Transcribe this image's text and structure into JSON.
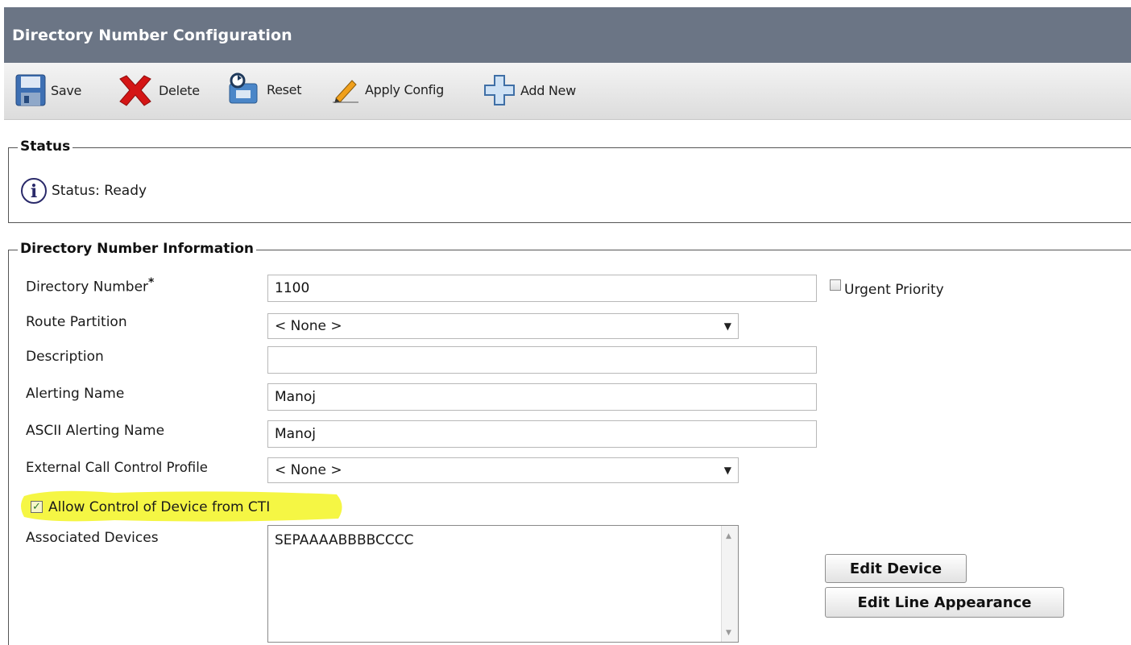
{
  "page": {
    "title": "Directory Number Configuration"
  },
  "toolbar": {
    "save": "Save",
    "delete": "Delete",
    "reset": "Reset",
    "apply_config": "Apply Config",
    "add_new": "Add New"
  },
  "status": {
    "legend": "Status",
    "text": "Status: Ready"
  },
  "dn_info": {
    "legend": "Directory Number Information",
    "fields": {
      "directory_number": {
        "label": "Directory Number",
        "required": "*",
        "value": "1100"
      },
      "urgent_priority": {
        "label": "Urgent Priority",
        "checked": false
      },
      "route_partition": {
        "label": "Route Partition",
        "value": "< None >"
      },
      "description": {
        "label": "Description",
        "value": ""
      },
      "alerting_name": {
        "label": "Alerting Name",
        "value": "Manoj"
      },
      "ascii_alerting_name": {
        "label": "ASCII Alerting Name",
        "value": "Manoj"
      },
      "external_call_control_profile": {
        "label": "External Call Control Profile",
        "value": "< None >"
      },
      "allow_cti": {
        "label": "Allow Control of Device from CTI",
        "checked": true
      },
      "associated_devices": {
        "label": "Associated Devices",
        "items": [
          "SEPAAAABBBBCCCC"
        ]
      }
    },
    "buttons": {
      "edit_device": "Edit Device",
      "edit_line_appearance": "Edit Line Appearance"
    }
  },
  "colors": {
    "header_bg": "#6b7585",
    "highlight": "#f4f534"
  }
}
